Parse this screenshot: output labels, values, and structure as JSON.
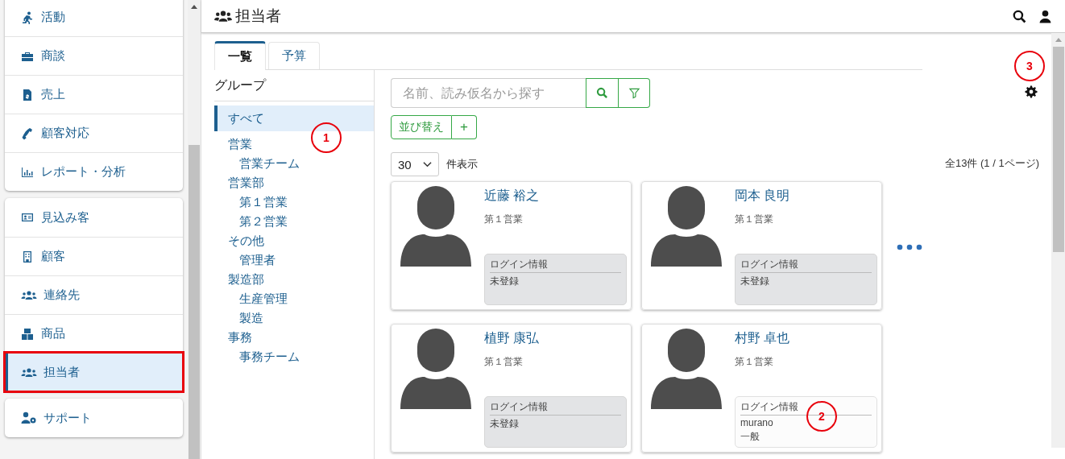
{
  "sidebar": {
    "groups": [
      {
        "items": [
          {
            "label": "活動",
            "selected": false,
            "highlighted": false
          },
          {
            "label": "商談",
            "selected": false,
            "highlighted": false
          },
          {
            "label": "売上",
            "selected": false,
            "highlighted": false
          },
          {
            "label": "顧客対応",
            "selected": false,
            "highlighted": false
          },
          {
            "label": "レポート・分析",
            "selected": false,
            "highlighted": false
          }
        ]
      },
      {
        "items": [
          {
            "label": "見込み客",
            "selected": false,
            "highlighted": false
          },
          {
            "label": "顧客",
            "selected": false,
            "highlighted": false
          },
          {
            "label": "連絡先",
            "selected": false,
            "highlighted": false
          },
          {
            "label": "商品",
            "selected": false,
            "highlighted": false
          },
          {
            "label": "担当者",
            "selected": true,
            "highlighted": true
          }
        ]
      },
      {
        "items": [
          {
            "label": "サポート",
            "selected": false,
            "highlighted": false
          }
        ]
      }
    ]
  },
  "header": {
    "title": "担当者"
  },
  "tabs": [
    {
      "label": "一覧",
      "selected": true
    },
    {
      "label": "予算",
      "selected": false
    }
  ],
  "group_panel": {
    "title": "グループ",
    "items": [
      {
        "label": "すべて",
        "selected": true
      },
      {
        "label": "営業",
        "selected": false,
        "children": [
          {
            "label": "営業チーム",
            "selected": false
          }
        ]
      },
      {
        "label": "営業部",
        "selected": false,
        "children": [
          {
            "label": "第１営業",
            "selected": false
          },
          {
            "label": "第２営業",
            "selected": false
          }
        ]
      },
      {
        "label": "その他",
        "selected": false,
        "children": [
          {
            "label": "管理者",
            "selected": false
          }
        ]
      },
      {
        "label": "製造部",
        "selected": false,
        "children": [
          {
            "label": "生産管理",
            "selected": false
          },
          {
            "label": "製造",
            "selected": false
          }
        ]
      },
      {
        "label": "事務",
        "selected": false,
        "children": [
          {
            "label": "事務チーム",
            "selected": false
          }
        ]
      }
    ]
  },
  "search": {
    "placeholder": "名前、読み仮名から探す"
  },
  "sort_button": "並び替え",
  "add_button": "+",
  "per_page": {
    "value": "30",
    "suffix": "件表示"
  },
  "total": "全13件 (1 / 1ページ)",
  "cards": [
    {
      "name": "近藤 裕之",
      "group": "第１営業",
      "login_title": "ログイン情報",
      "registered": false,
      "login_lines": [
        "未登録"
      ]
    },
    {
      "name": "岡本 良明",
      "group": "第１営業",
      "login_title": "ログイン情報",
      "registered": false,
      "login_lines": [
        "未登録"
      ]
    },
    {
      "name": "植野 康弘",
      "group": "第１営業",
      "login_title": "ログイン情報",
      "registered": false,
      "login_lines": [
        "未登録"
      ]
    },
    {
      "name": "村野 卓也",
      "group": "第１営業",
      "login_title": "ログイン情報",
      "registered": true,
      "login_lines": [
        "murano",
        "一般"
      ]
    }
  ],
  "callouts": [
    {
      "label": "1"
    },
    {
      "label": "2"
    },
    {
      "label": "3"
    }
  ]
}
